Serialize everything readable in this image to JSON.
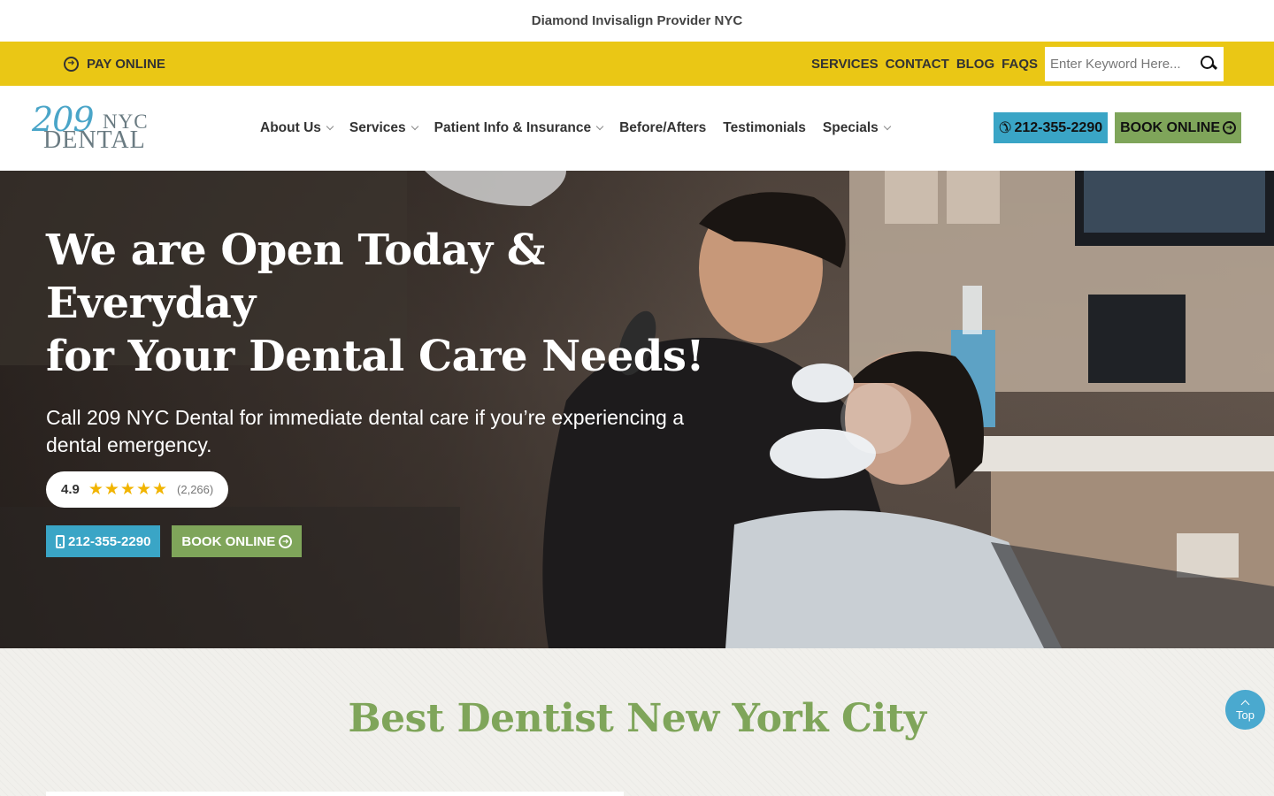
{
  "announcement": "Diamond Invisalign Provider NYC",
  "utility": {
    "pay_online": "PAY ONLINE",
    "links": [
      "SERVICES",
      "CONTACT",
      "BLOG",
      "FAQS"
    ],
    "search_placeholder": "Enter Keyword Here..."
  },
  "logo": {
    "part1": "209",
    "part2": "NYC",
    "part3": "DENTAL"
  },
  "nav": [
    {
      "label": "About Us",
      "dropdown": true
    },
    {
      "label": "Services",
      "dropdown": true
    },
    {
      "label": "Patient Info & Insurance",
      "dropdown": true
    },
    {
      "label": "Before/Afters",
      "dropdown": false
    },
    {
      "label": "Testimonials",
      "dropdown": false
    },
    {
      "label": "Specials",
      "dropdown": true
    }
  ],
  "header_cta": {
    "phone": "212-355-2290",
    "book": "BOOK ONLINE"
  },
  "hero": {
    "title_line1": "We are Open Today & Everyday",
    "title_line2": "for Your Dental Care Needs!",
    "subtitle": "Call 209 NYC Dental for immediate dental care if you’re experiencing a dental emergency.",
    "rating": {
      "score": "4.9",
      "stars": "★★★★★",
      "count": "(2,266)",
      "value": 4.9,
      "max": 5
    },
    "phone": "212-355-2290",
    "book": "BOOK ONLINE"
  },
  "section": {
    "heading": "Best Dentist New York City"
  },
  "to_top": "Top",
  "colors": {
    "yellow_bar": "#eac715",
    "blue": "#3aa5c6",
    "green": "#7fa55a",
    "heading_green": "#7fa55a"
  }
}
